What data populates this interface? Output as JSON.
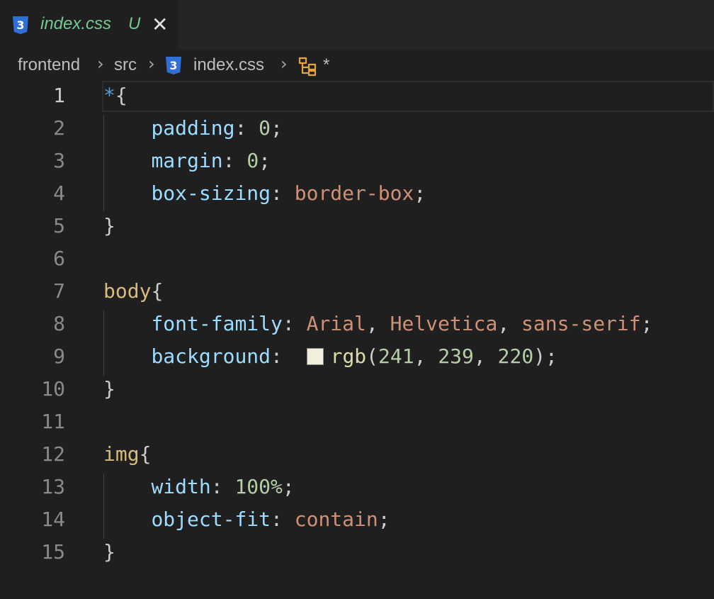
{
  "tab": {
    "title": "index.css",
    "status": "U",
    "close": "✕",
    "icon": "css3-icon"
  },
  "breadcrumb": {
    "items": [
      "frontend",
      "src",
      "index.css",
      "*"
    ],
    "separator": "›"
  },
  "editor": {
    "line_numbers": [
      "1",
      "2",
      "3",
      "4",
      "5",
      "6",
      "7",
      "8",
      "9",
      "10",
      "11",
      "12",
      "13",
      "14",
      "15"
    ],
    "active_line": 1,
    "lines": [
      [
        {
          "t": "*",
          "c": "sel"
        },
        {
          "t": "{",
          "c": "p"
        }
      ],
      [
        {
          "t": "    ",
          "c": "p"
        },
        {
          "t": "padding",
          "c": "prop"
        },
        {
          "t": ": ",
          "c": "p"
        },
        {
          "t": "0",
          "c": "num"
        },
        {
          "t": ";",
          "c": "p"
        }
      ],
      [
        {
          "t": "    ",
          "c": "p"
        },
        {
          "t": "margin",
          "c": "prop"
        },
        {
          "t": ": ",
          "c": "p"
        },
        {
          "t": "0",
          "c": "num"
        },
        {
          "t": ";",
          "c": "p"
        }
      ],
      [
        {
          "t": "    ",
          "c": "p"
        },
        {
          "t": "box-sizing",
          "c": "prop"
        },
        {
          "t": ": ",
          "c": "p"
        },
        {
          "t": "border-box",
          "c": "val"
        },
        {
          "t": ";",
          "c": "p"
        }
      ],
      [
        {
          "t": "}",
          "c": "p"
        }
      ],
      [],
      [
        {
          "t": "body",
          "c": "tag"
        },
        {
          "t": "{",
          "c": "p"
        }
      ],
      [
        {
          "t": "    ",
          "c": "p"
        },
        {
          "t": "font-family",
          "c": "prop"
        },
        {
          "t": ": ",
          "c": "p"
        },
        {
          "t": "Arial",
          "c": "val"
        },
        {
          "t": ", ",
          "c": "p"
        },
        {
          "t": "Helvetica",
          "c": "val"
        },
        {
          "t": ", ",
          "c": "p"
        },
        {
          "t": "sans-serif",
          "c": "val"
        },
        {
          "t": ";",
          "c": "p"
        }
      ],
      [
        {
          "t": "    ",
          "c": "p"
        },
        {
          "t": "background",
          "c": "prop"
        },
        {
          "t": ":  ",
          "c": "p"
        },
        {
          "t": "",
          "c": "swatch",
          "color": "#f1efdc"
        },
        {
          "t": "rgb",
          "c": "fn"
        },
        {
          "t": "(",
          "c": "p"
        },
        {
          "t": "241",
          "c": "num"
        },
        {
          "t": ", ",
          "c": "p"
        },
        {
          "t": "239",
          "c": "num"
        },
        {
          "t": ", ",
          "c": "p"
        },
        {
          "t": "220",
          "c": "num"
        },
        {
          "t": ");",
          "c": "p"
        }
      ],
      [
        {
          "t": "}",
          "c": "p"
        }
      ],
      [],
      [
        {
          "t": "img",
          "c": "tag"
        },
        {
          "t": "{",
          "c": "p"
        }
      ],
      [
        {
          "t": "    ",
          "c": "p"
        },
        {
          "t": "width",
          "c": "prop"
        },
        {
          "t": ": ",
          "c": "p"
        },
        {
          "t": "100%",
          "c": "num"
        },
        {
          "t": ";",
          "c": "p"
        }
      ],
      [
        {
          "t": "    ",
          "c": "p"
        },
        {
          "t": "object-fit",
          "c": "prop"
        },
        {
          "t": ": ",
          "c": "p"
        },
        {
          "t": "contain",
          "c": "val"
        },
        {
          "t": ";",
          "c": "p"
        }
      ],
      [
        {
          "t": "}",
          "c": "p"
        }
      ]
    ]
  },
  "colors": {
    "background": "#1f1f1f",
    "tab_title": "#73c991",
    "css_icon": "#2f6fd6",
    "property": "#9cdcfe",
    "selector": "#d7ba7d",
    "number": "#b5cea8",
    "string_value": "#ce9178",
    "function": "#dcdcaa"
  }
}
